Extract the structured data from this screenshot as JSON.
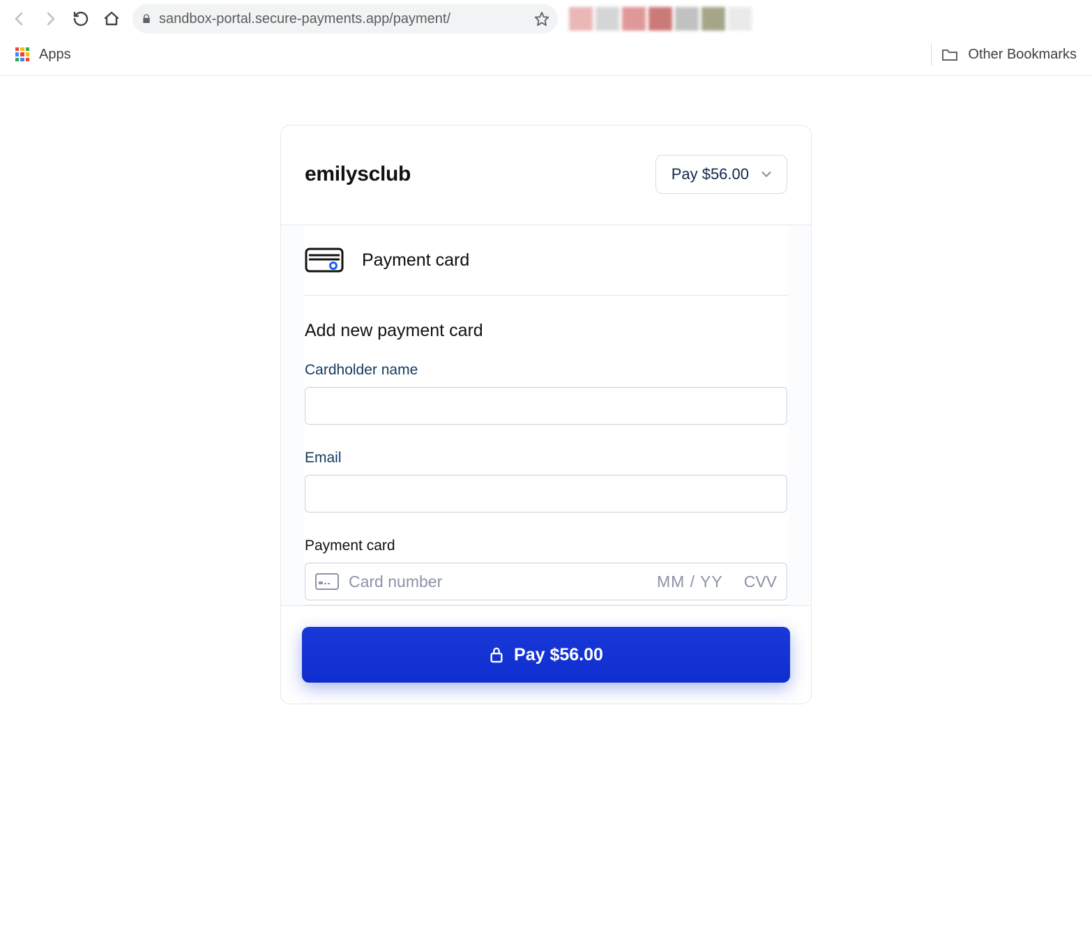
{
  "browser": {
    "url": "sandbox-portal.secure-payments.app/payment/",
    "apps_label": "Apps",
    "other_bookmarks_label": "Other Bookmarks"
  },
  "checkout": {
    "merchant_name": "emilysclub",
    "pay_summary_label": "Pay $56.00",
    "method_title": "Payment card",
    "section_heading": "Add new payment card",
    "labels": {
      "cardholder": "Cardholder name",
      "email": "Email",
      "payment_card": "Payment card"
    },
    "placeholders": {
      "card_number": "Card number",
      "expiry": "MM / YY",
      "cvv": "CVV"
    },
    "pay_button_label": "Pay $56.00"
  }
}
